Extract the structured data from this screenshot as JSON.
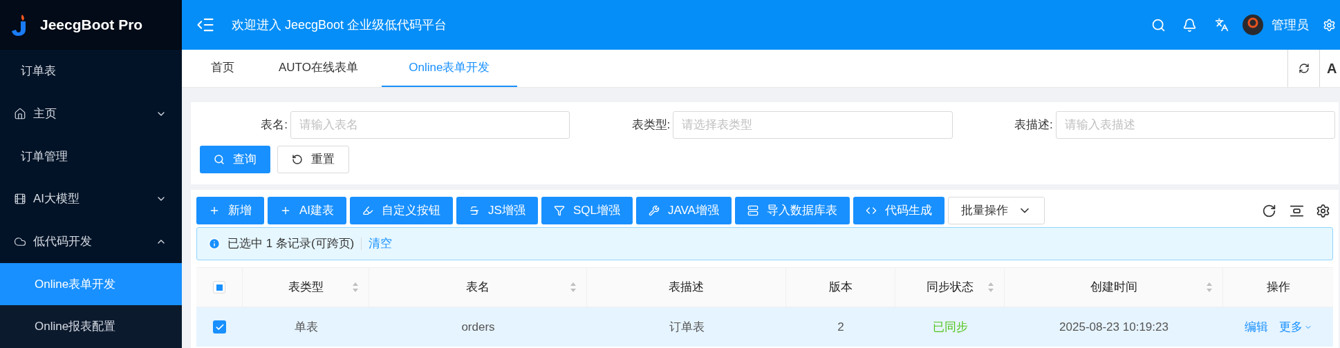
{
  "logo": {
    "name": "JeecgBoot Pro"
  },
  "header": {
    "title": "欢迎进入 JeecgBoot 企业级低代码平台",
    "user": "管理员"
  },
  "sidebar": {
    "items": [
      {
        "label": "订单表",
        "selected": false
      },
      {
        "label": "主页",
        "selected": false,
        "expanded": false
      },
      {
        "label": "订单管理",
        "selected": false
      },
      {
        "label": "AI大模型",
        "selected": false,
        "expanded": false
      },
      {
        "label": "低代码开发",
        "selected": false,
        "expanded": true,
        "children": [
          {
            "label": "Online表单开发",
            "selected": true
          },
          {
            "label": "Online报表配置",
            "selected": false
          }
        ]
      }
    ]
  },
  "tabs": [
    {
      "label": "首页",
      "selected": false
    },
    {
      "label": "AUTO在线表单",
      "selected": false
    },
    {
      "label": "Online表单开发",
      "selected": true
    }
  ],
  "tab_bar_edge": "A",
  "search_form": {
    "fields": [
      {
        "label": "表名:",
        "placeholder": "请输入表名"
      },
      {
        "label": "表类型:",
        "placeholder": "请选择表类型"
      },
      {
        "label": "表描述:",
        "placeholder": "请输入表描述"
      }
    ],
    "buttons": [
      {
        "label": "查询",
        "kind": "primary"
      },
      {
        "label": "重置",
        "kind": "default"
      }
    ]
  },
  "toolbar": {
    "buttons": [
      {
        "label": "新增",
        "kind": "primary"
      },
      {
        "label": "AI建表",
        "kind": "primary"
      },
      {
        "label": "自定义按钮",
        "kind": "primary"
      },
      {
        "label": "JS增强",
        "kind": "primary"
      },
      {
        "label": "SQL增强",
        "kind": "primary"
      },
      {
        "label": "JAVA增强",
        "kind": "primary"
      },
      {
        "label": "导入数据库表",
        "kind": "primary"
      },
      {
        "label": "代码生成",
        "kind": "primary"
      },
      {
        "label": "批量操作",
        "kind": "dropdown"
      }
    ]
  },
  "alert": {
    "text": "已选中 1 条记录(可跨页)",
    "link": "清空"
  },
  "table": {
    "select_all_indeterminate": true,
    "columns": [
      {
        "title": "表类型",
        "sortable": true
      },
      {
        "title": "表名",
        "sortable": true
      },
      {
        "title": "表描述",
        "sortable": false
      },
      {
        "title": "版本",
        "sortable": false
      },
      {
        "title": "同步状态",
        "sortable": true
      },
      {
        "title": "创建时间",
        "sortable": true
      },
      {
        "title": "操作",
        "sortable": false
      }
    ],
    "rows": [
      {
        "selected": true,
        "cells": [
          {
            "text": "单表"
          },
          {
            "text": "orders"
          },
          {
            "text": "订单表"
          },
          {
            "text": "2"
          },
          {
            "text": "已同步",
            "kind": "success"
          },
          {
            "text": "2025-08-23 10:19:23"
          }
        ],
        "actions": [
          {
            "label": "编辑",
            "kind": "link"
          },
          {
            "label": "更多",
            "kind": "menu"
          }
        ]
      }
    ]
  }
}
